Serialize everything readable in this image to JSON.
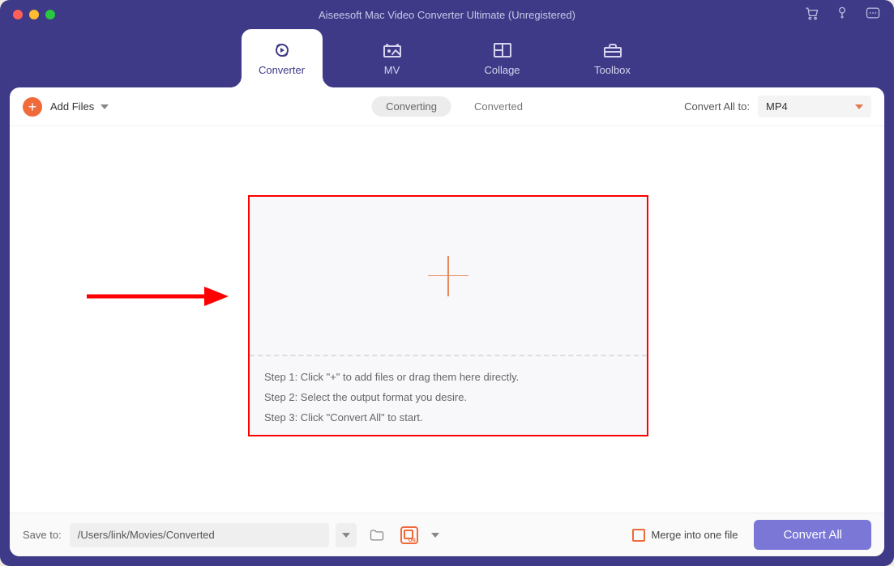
{
  "window": {
    "title": "Aiseesoft Mac Video Converter Ultimate (Unregistered)"
  },
  "tabs": {
    "converter": "Converter",
    "mv": "MV",
    "collage": "Collage",
    "toolbox": "Toolbox"
  },
  "toolbar": {
    "add_files": "Add Files",
    "converting": "Converting",
    "converted": "Converted",
    "convert_all_to": "Convert All to:",
    "format": "MP4"
  },
  "dropzone": {
    "step1": "Step 1: Click \"+\" to add files or drag them here directly.",
    "step2": "Step 2: Select the output format you desire.",
    "step3": "Step 3: Click \"Convert All\" to start."
  },
  "footer": {
    "save_to_label": "Save to:",
    "save_path": "/Users/link/Movies/Converted",
    "merge_label": "Merge into one file",
    "convert_all": "Convert All"
  }
}
